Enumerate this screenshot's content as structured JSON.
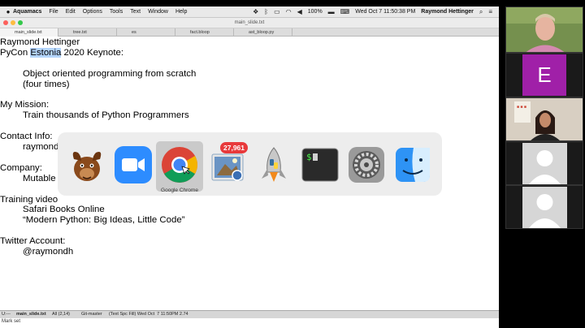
{
  "menubar": {
    "app": "Aquamacs",
    "items": [
      "File",
      "Edit",
      "Options",
      "Tools",
      "Text",
      "Window",
      "Help"
    ],
    "battery": "100%",
    "clock": "Wed Oct 7 11:50:38 PM",
    "user": "Raymond Hettinger"
  },
  "window": {
    "title": "main_slide.txt"
  },
  "tabs": [
    "main_slide.txt",
    "tree.txt",
    "es",
    "fact.bloop",
    "ast_bloop.py"
  ],
  "editor": {
    "lines": [
      {
        "text": "Raymond Hettinger",
        "indent": false
      },
      {
        "text": "PyCon Estonia 2020 Keynote:",
        "indent": false,
        "highlight": "Estonia"
      },
      {
        "text": "",
        "indent": false
      },
      {
        "text": "Object oriented programming from scratch",
        "indent": true
      },
      {
        "text": "(four times)",
        "indent": true
      },
      {
        "text": "",
        "indent": false
      },
      {
        "text": "My Mission:",
        "indent": false
      },
      {
        "text": "Train thousands of Python Programmers",
        "indent": true
      },
      {
        "text": "",
        "indent": false
      },
      {
        "text": "Contact Info:",
        "indent": false
      },
      {
        "text": "raymond",
        "indent": true
      },
      {
        "text": "",
        "indent": false
      },
      {
        "text": "Company:",
        "indent": false
      },
      {
        "text": "Mutable",
        "indent": true
      },
      {
        "text": "",
        "indent": false
      },
      {
        "text": "Training video",
        "indent": false
      },
      {
        "text": "Safari Books Online",
        "indent": true
      },
      {
        "text": "“Modern Python: Big Ideas, Little Code”",
        "indent": true
      },
      {
        "text": "",
        "indent": false
      },
      {
        "text": "Twitter Account:",
        "indent": false
      },
      {
        "text": "@raymondh",
        "indent": true
      }
    ]
  },
  "modeline": {
    "prefix": "U:---",
    "buffer": "main_slide.txt",
    "position": "All (2,14)",
    "vcs": "Git-master",
    "modes": "(Text Spc Fill) Wed Oct  7 11:50PM 2.74"
  },
  "echo": "Mark set",
  "switcher": {
    "selected_label": "Google Chrome",
    "badge": "27,961",
    "apps": [
      "gnu-icon",
      "zoom-icon",
      "chrome-icon",
      "mail-icon",
      "python-launcher-icon",
      "terminal-icon",
      "system-preferences-icon",
      "finder-icon"
    ]
  },
  "participants": {
    "tiles": [
      {
        "kind": "video",
        "name": ""
      },
      {
        "kind": "initial",
        "letter": "E",
        "color": "#a020a8"
      },
      {
        "kind": "video",
        "name": ""
      },
      {
        "kind": "avatar",
        "name": ""
      },
      {
        "kind": "avatar",
        "name": ""
      }
    ]
  }
}
